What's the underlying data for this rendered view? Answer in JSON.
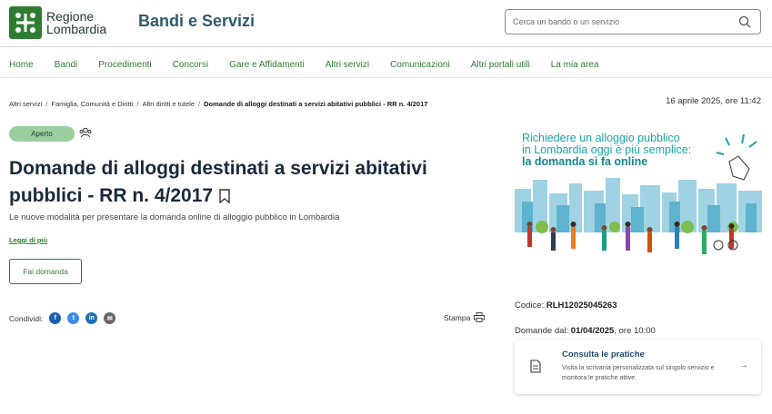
{
  "header": {
    "logo_line1": "Regione",
    "logo_line2": "Lombardia",
    "site_title": "Bandi e Servizi",
    "search_placeholder": "Cerca un bando o un servizio"
  },
  "nav": [
    "Home",
    "Bandi",
    "Procedimenti",
    "Concorsi",
    "Gare e Affidamenti",
    "Altri servizi",
    "Comunicazioni",
    "Altri portali utili",
    "La mia area"
  ],
  "breadcrumb": {
    "items": [
      "Altri servizi",
      "Famiglia, Comunità e Diritti",
      "Altri diritti e tutele"
    ],
    "separator": "/",
    "current": "Domande di alloggi destinati a servizi abitativi pubblici - RR n. 4/2017"
  },
  "date": "16 aprile 2025, ore 11:42",
  "main": {
    "status_badge": "Aperto",
    "title": "Domande di alloggi destinati a servizi abitativi pubblici - RR n. 4/2017",
    "subtitle": "Le nuove modalità per presentare la domanda online di alloggio pubblico in Lombardia",
    "read_more": "Leggi di più",
    "apply_button": "Fai domanda",
    "share_label": "Condividi:",
    "print_label": "Stampa"
  },
  "sidebar": {
    "promo_line1": "Richiedere un alloggio pubblico",
    "promo_line2": "in Lombardia oggi è più semplice:",
    "promo_line3": "la domanda si fa online",
    "code_label": "Codice:",
    "code_value": "RLH12025045263",
    "applications_label": "Domande dal:",
    "applications_date": "01/04/2025",
    "applications_time": ", ore 10:00",
    "card_title": "Consulta le pratiche",
    "card_desc": "Visita la scrivania personalizzata sul singolo servizio e monitora le pratiche attive."
  },
  "colors": {
    "brand_green": "#2f7d32",
    "badge_green": "#9ccf9f",
    "site_title_blue": "#2e5a6e",
    "promo_teal": "#1aa5a8"
  }
}
